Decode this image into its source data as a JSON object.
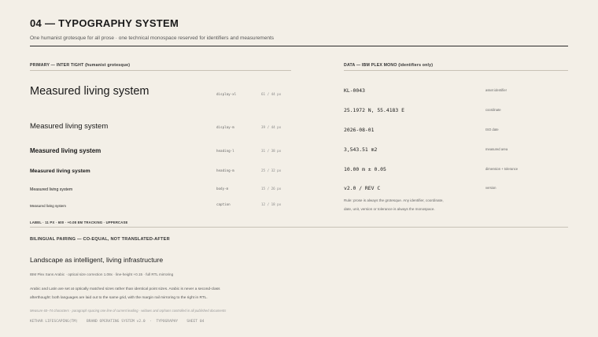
{
  "header": {
    "title": "04 — TYPOGRAPHY SYSTEM",
    "subtitle": "One humanist grotesque for all prose · one technical monospace reserved for identifiers and measurements"
  },
  "primary": {
    "label": "PRIMARY — INTER TIGHT (humanist grotesque)",
    "rows": [
      {
        "sample": "Measured living system",
        "token": "display-xl",
        "size": "61 / 44 px"
      },
      {
        "sample": "Measured living system",
        "token": "display-m",
        "size": "39 / 44 px"
      },
      {
        "sample": "Measured living system",
        "token": "heading-l",
        "size": "31 / 38 px"
      },
      {
        "sample": "Measured living system",
        "token": "heading-m",
        "size": "25 / 32 px"
      },
      {
        "sample": "Measured living system",
        "token": "body-m",
        "size": "15 / 26 px"
      },
      {
        "sample": "Measured living system",
        "token": "caption",
        "size": "12 / 18 px"
      }
    ],
    "label_spec": "LABEL · 11 PX · 600 · +0.08 EM TRACKING · UPPERCASE"
  },
  "data_font": {
    "label": "DATA — IBM PLEX MONO (identifiers only)",
    "rows": [
      {
        "value": "KL-0043",
        "tag": "asset identifier"
      },
      {
        "value": "25.1972 N, 55.4183 E",
        "tag": "coordinate"
      },
      {
        "value": "2026-08-01",
        "tag": "ISO date"
      },
      {
        "value": "3,543.51 m2",
        "tag": "measured area"
      },
      {
        "value": "10.00 m ± 0.05",
        "tag": "dimension + tolerance"
      },
      {
        "value": "v2.0 / REV C",
        "tag": "version"
      }
    ],
    "rule_line1": "Rule: prose is always the grotesque. Any identifier, coordinate,",
    "rule_line2": "date, unit, version or tolerance is always the monospace."
  },
  "bilingual": {
    "label": "BILINGUAL PAIRING — CO-EQUAL, NOT TRANSLATED-AFTER",
    "heading": "Landscape as intelligent, living infrastructure",
    "meta": "IBM Plex Sans Arabic · optical size correction 1.08x · line-height +0.15 · full RTL mirroring",
    "body1": "Arabic and Latin are set at optically matched sizes rather than identical point sizes. Arabic is never a second-class",
    "body2": "afterthought: both languages are laid out to the same grid, with the margin rail mirroring to the right in RTL.",
    "note": "Measure 60–74 characters · paragraph spacing one line of current leading · widows and orphans controlled in all published documents"
  },
  "footer": {
    "brand": "KETHAR LIFESCAPING(TM)",
    "system": "BRAND OPERATING SYSTEM v2.0",
    "section": "TYPOGRAPHY",
    "sheet": "SHEET 04"
  },
  "colors": {
    "background": "#f3efe7",
    "ink": "#1a1a1a",
    "rule": "#2a2a2a"
  }
}
